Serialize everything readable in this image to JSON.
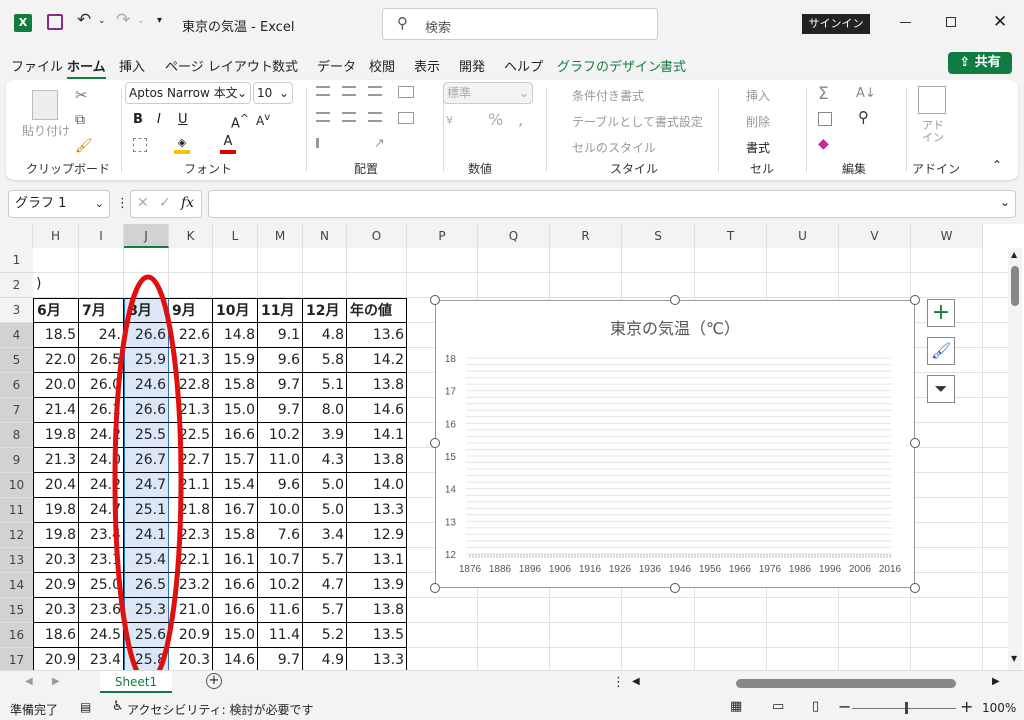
{
  "title": {
    "doc": "東京の気温",
    "sep": "-",
    "app": "Excel",
    "search": "検索",
    "signin": "サインイン",
    "zoom_btn": "□"
  },
  "menu": {
    "file": "ファイル",
    "home": "ホーム",
    "insert": "挿入",
    "layout": "ページ レイアウト",
    "formulas": "数式",
    "data": "データ",
    "review": "校閲",
    "view": "表示",
    "dev": "開発",
    "help": "ヘルプ",
    "chart_design": "グラフのデザイン",
    "format": "書式",
    "share": "共有"
  },
  "ribbon": {
    "paste": "貼り付け",
    "clipboard": "クリップボード",
    "font_name": "Aptos Narrow 本文",
    "font_size": "10",
    "font": "フォント",
    "align": "配置",
    "number_format": "標準",
    "number": "数値",
    "cond": "条件付き書式",
    "as_table": "テーブルとして書式設定",
    "cell_style": "セルのスタイル",
    "style": "スタイル",
    "insert": "挿入",
    "delete": "削除",
    "format": "書式",
    "cells": "セル",
    "edit": "編集",
    "addin": "アド\nイン",
    "addin_group": "アドイン"
  },
  "formula": {
    "namebox": "グラフ 1",
    "fx": "fx"
  },
  "columns": [
    "H",
    "I",
    "J",
    "K",
    "L",
    "M",
    "N",
    "O",
    "P",
    "Q",
    "R",
    "S",
    "T",
    "U",
    "V",
    "W"
  ],
  "rows": [
    "1",
    "2",
    "3",
    "4",
    "5",
    "6",
    "7",
    "8",
    "9",
    "10",
    "11",
    "12",
    "13",
    "14",
    "15",
    "16",
    "17"
  ],
  "a2": ")",
  "table": {
    "headers": [
      "6月",
      "7月",
      "8月",
      "9月",
      "10月",
      "11月",
      "12月",
      "年の値"
    ],
    "data": [
      [
        "18.5",
        "24.",
        "26.6",
        "22.6",
        "14.8",
        "9.1",
        "4.8",
        "13.6"
      ],
      [
        "22.0",
        "26.5",
        "25.9",
        "21.3",
        "15.9",
        "9.6",
        "5.8",
        "14.2"
      ],
      [
        "20.0",
        "26.0",
        "24.6",
        "22.8",
        "15.8",
        "9.7",
        "5.1",
        "13.8"
      ],
      [
        "21.4",
        "26.1",
        "26.6",
        "21.3",
        "15.0",
        "9.7",
        "8.0",
        "14.6"
      ],
      [
        "19.8",
        "24.2",
        "25.5",
        "22.5",
        "16.6",
        "10.2",
        "3.9",
        "14.1"
      ],
      [
        "21.3",
        "24.0",
        "26.7",
        "22.7",
        "15.7",
        "11.0",
        "4.3",
        "13.8"
      ],
      [
        "20.4",
        "24.2",
        "24.7",
        "21.1",
        "15.4",
        "9.6",
        "5.0",
        "14.0"
      ],
      [
        "19.8",
        "24.7",
        "25.1",
        "21.8",
        "16.7",
        "10.0",
        "5.0",
        "13.3"
      ],
      [
        "19.8",
        "23.4",
        "24.1",
        "22.3",
        "15.8",
        "7.6",
        "3.4",
        "12.9"
      ],
      [
        "20.3",
        "23.1",
        "25.4",
        "22.1",
        "16.1",
        "10.7",
        "5.7",
        "13.1"
      ],
      [
        "20.9",
        "25.0",
        "26.5",
        "23.2",
        "16.6",
        "10.2",
        "4.7",
        "13.9"
      ],
      [
        "20.3",
        "23.6",
        "25.3",
        "21.0",
        "16.6",
        "11.6",
        "5.7",
        "13.8"
      ],
      [
        "18.6",
        "24.5",
        "25.6",
        "20.9",
        "15.0",
        "11.4",
        "5.2",
        "13.5"
      ],
      [
        "20.9",
        "23.4",
        "25.8",
        "20.3",
        "14.6",
        "9.7",
        "4.9",
        "13.3"
      ]
    ]
  },
  "chart_data": {
    "type": "line",
    "title": "東京の気温（℃）",
    "ylim": [
      12,
      18
    ],
    "y_ticks": [
      "12",
      "13",
      "14",
      "15",
      "16",
      "17",
      "18"
    ],
    "x_ticks": [
      "1876",
      "1886",
      "1896",
      "1906",
      "1916",
      "1926",
      "1936",
      "1946",
      "1956",
      "1966",
      "1976",
      "1986",
      "1996",
      "2006",
      "2016"
    ],
    "series": []
  },
  "sheet": {
    "tab": "Sheet1"
  },
  "status": {
    "ready": "準備完了",
    "access": "アクセシビリティ: 検討が必要です",
    "zoom": "100%"
  },
  "colors": {
    "accent": "#107c41",
    "selection": "#dbe7f6",
    "ellipse": "#e01010"
  }
}
